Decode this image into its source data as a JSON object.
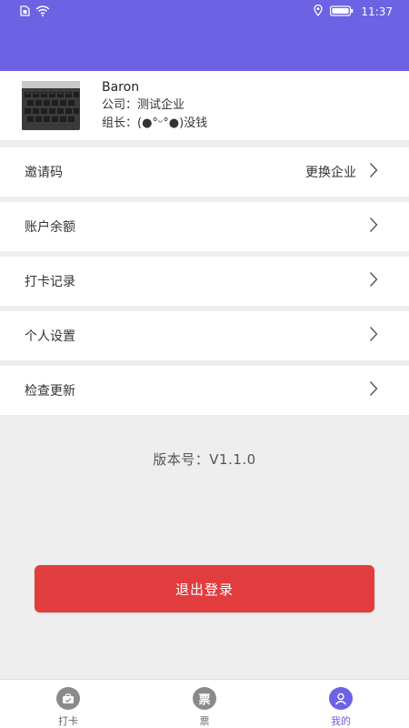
{
  "status_bar": {
    "time": "11:37",
    "sim_icon": "sim-card-icon",
    "wifi_icon": "wifi-icon",
    "location_icon": "location-icon",
    "battery_icon": "battery-icon"
  },
  "profile": {
    "name": "Baron",
    "company": "公司：测试企业",
    "leader": "组长：(●°ᵕ°●)没钱"
  },
  "menu": [
    {
      "label": "邀请码",
      "extra": "更换企业"
    },
    {
      "label": "账户余额",
      "extra": ""
    },
    {
      "label": "打卡记录",
      "extra": ""
    },
    {
      "label": "个人设置",
      "extra": ""
    },
    {
      "label": "检查更新",
      "extra": ""
    }
  ],
  "version_text": "版本号：V1.1.0",
  "logout_label": "退出登录",
  "tabs": [
    {
      "label": "打卡",
      "icon": "clock-in-icon",
      "glyph": ""
    },
    {
      "label": "票",
      "icon": "ticket-icon",
      "glyph": "票"
    },
    {
      "label": "我的",
      "icon": "user-icon",
      "glyph": ""
    }
  ],
  "colors": {
    "brand": "#6c62e3",
    "danger": "#e13d3f",
    "background": "#efeeef"
  }
}
